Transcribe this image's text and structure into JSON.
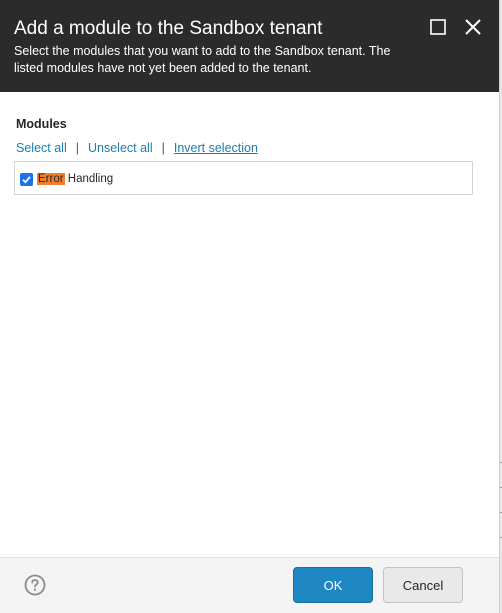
{
  "dialog": {
    "title": "Add a module to the Sandbox tenant",
    "description": "Select the modules that you want to add to the Sandbox tenant. The listed modules have not yet been added to the tenant."
  },
  "modules": {
    "label": "Modules",
    "select_all": "Select all",
    "unselect_all": "Unselect all",
    "invert_selection": "Invert selection",
    "separator": "|",
    "items": [
      {
        "highlight": "Error",
        "rest": " Handling",
        "checked": true
      }
    ]
  },
  "footer": {
    "ok_label": "OK",
    "cancel_label": "Cancel"
  },
  "icons": {
    "maximize": "maximize-icon",
    "close": "close-icon",
    "help": "help-icon",
    "checkbox": "checkbox-checked-icon"
  },
  "colors": {
    "header_bg": "#2b2b2b",
    "link": "#1a7fb0",
    "primary_button": "#1f87c1",
    "highlight": "#f08030",
    "checkbox": "#1a73e8"
  }
}
